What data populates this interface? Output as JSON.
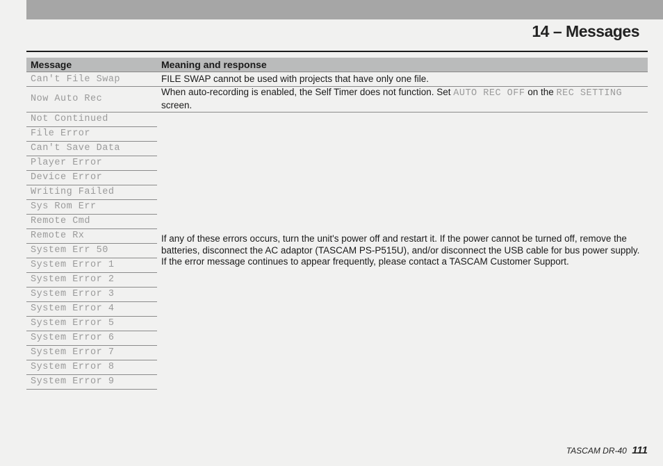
{
  "chapter_title": "14 – Messages",
  "table": {
    "head_message": "Message",
    "head_meaning": "Meaning and response"
  },
  "row_swap": {
    "msg": "Can't File Swap",
    "meaning": "FILE SWAP cannot be used with projects that have only one file."
  },
  "row_auto": {
    "msg": "Now Auto Rec",
    "meaning_a": "When auto-recording is enabled, the Self Timer does not function. Set ",
    "code_a": "AUTO REC OFF",
    "meaning_b": " on the ",
    "code_b": "REC SETTING",
    "meaning_c": " screen."
  },
  "errs": {
    "r0": "Not Continued",
    "r1": "File Error",
    "r2": "Can't Save Data",
    "r3": "Player Error",
    "r4": "Device Error",
    "r5": "Writing Failed",
    "r6": "Sys Rom Err",
    "r7": "Remote Cmd",
    "r8": "Remote Rx",
    "r9": "System Err 50",
    "r10": "System Error 1",
    "r11": "System Error 2",
    "r12": "System Error 3",
    "r13": "System Error 4",
    "r14": "System Error 5",
    "r15": "System Error 6",
    "r16": "System Error 7",
    "r17": "System Error 8",
    "r18": "System Error 9"
  },
  "err_meaning": "If any of these errors occurs, turn the unit's power off and restart it. If the power cannot be turned off, remove the batteries, disconnect the AC adaptor (TASCAM PS-P515U), and/or disconnect the USB cable for bus power supply. If the error message continues to appear frequently, please contact a TASCAM Customer Support.",
  "footer": {
    "product": "TASCAM DR-40",
    "page": "111"
  }
}
